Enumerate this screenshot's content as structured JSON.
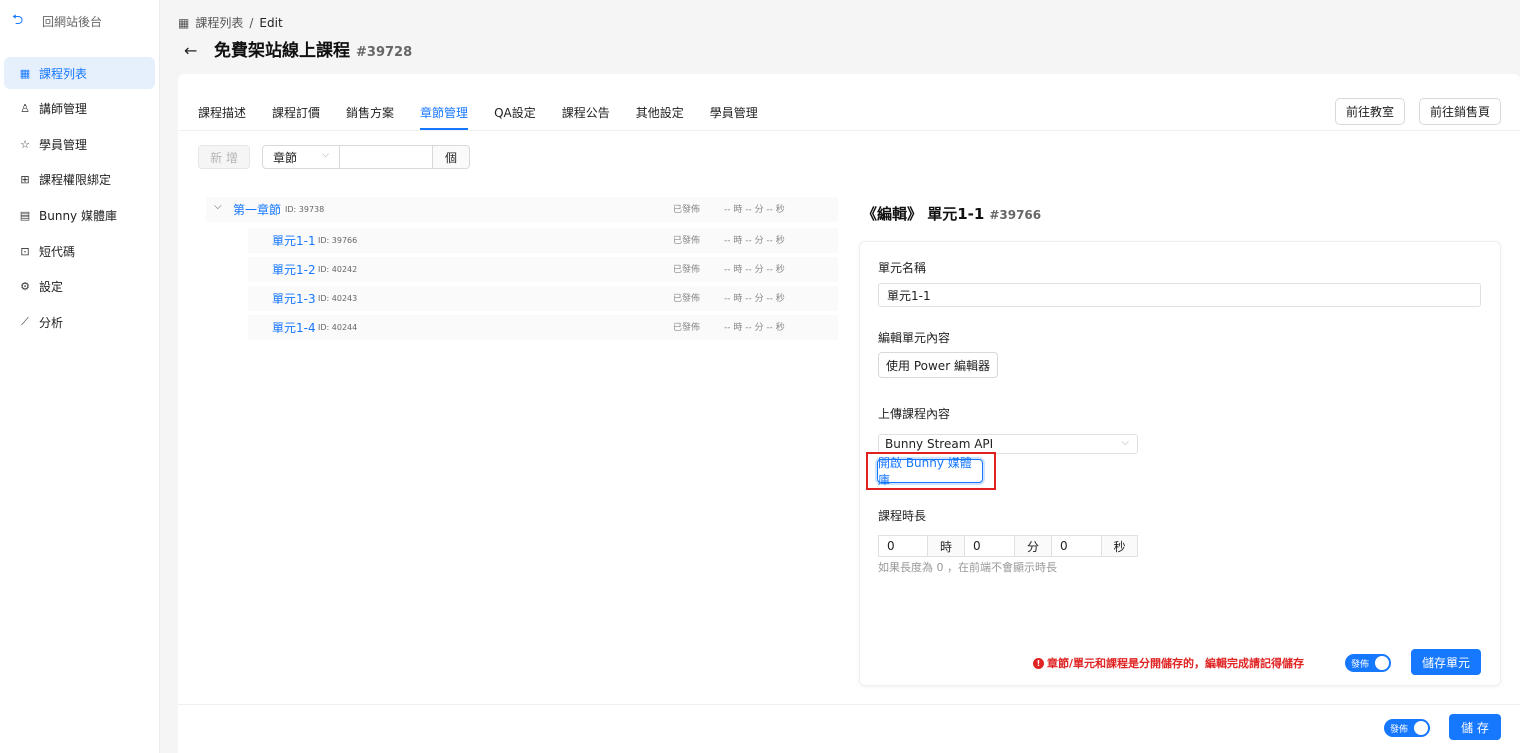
{
  "sidebar": {
    "back_label": "回網站後台",
    "items": [
      {
        "label": "課程列表",
        "icon": "table-icon",
        "glyph": "▦"
      },
      {
        "label": "講師管理",
        "icon": "user-icon",
        "glyph": "♙"
      },
      {
        "label": "學員管理",
        "icon": "student-icon",
        "glyph": "☆"
      },
      {
        "label": "課程權限綁定",
        "icon": "apps-icon",
        "glyph": "⊞"
      },
      {
        "label": "Bunny 媒體庫",
        "icon": "media-library-icon",
        "glyph": "▤"
      },
      {
        "label": "短代碼",
        "icon": "code-icon",
        "glyph": "⊡"
      },
      {
        "label": "設定",
        "icon": "gear-icon",
        "glyph": "⚙"
      },
      {
        "label": "分析",
        "icon": "chart-icon",
        "glyph": "⟋"
      }
    ]
  },
  "breadcrumb": {
    "root": "課程列表",
    "sep": "/",
    "current": "Edit"
  },
  "header": {
    "title": "免費架站線上課程",
    "id": "#39728"
  },
  "tabs": [
    "課程描述",
    "課程訂價",
    "銷售方案",
    "章節管理",
    "QA設定",
    "課程公告",
    "其他設定",
    "學員管理"
  ],
  "active_tab": "章節管理",
  "top_buttons": {
    "classroom": "前往教室",
    "sales_page": "前往銷售頁"
  },
  "toolbar": {
    "add_label": "新 增",
    "type_value": "章節",
    "count_suffix": "個"
  },
  "tree": {
    "chapter": {
      "name": "第一章節",
      "id": "ID: 39738",
      "status": "已發佈",
      "duration": "-- 時 -- 分 -- 秒"
    },
    "units": [
      {
        "name": "單元1-1",
        "id": "ID: 39766",
        "status": "已發佈",
        "duration": "-- 時 -- 分 -- 秒"
      },
      {
        "name": "單元1-2",
        "id": "ID: 40242",
        "status": "已發佈",
        "duration": "-- 時 -- 分 -- 秒"
      },
      {
        "name": "單元1-3",
        "id": "ID: 40243",
        "status": "已發佈",
        "duration": "-- 時 -- 分 -- 秒"
      },
      {
        "name": "單元1-4",
        "id": "ID: 40244",
        "status": "已發佈",
        "duration": "-- 時 -- 分 -- 秒"
      }
    ]
  },
  "edit": {
    "title": "《編輯》 單元1-1",
    "id": "#39766",
    "unit_name_label": "單元名稱",
    "unit_name_value": "單元1-1",
    "content_label": "編輯單元內容",
    "editor_button": "使用 Power 編輯器",
    "upload_label": "上傳課程內容",
    "upload_select": "Bunny Stream API",
    "bunny_button": "開啟 Bunny 媒體庫",
    "duration_label": "課程時長",
    "hours": "0",
    "hours_unit": "時",
    "minutes": "0",
    "minutes_unit": "分",
    "seconds": "0",
    "seconds_unit": "秒",
    "duration_hint": "如果長度為 0 ，在前端不會顯示時長",
    "warning": "章節/單元和課程是分開儲存的，編輯完成請記得儲存",
    "publish_toggle": "發佈",
    "save_unit": "儲存單元"
  },
  "footer": {
    "publish_toggle": "發佈",
    "save": "儲 存"
  },
  "colors": {
    "accent": "#1677ff",
    "warning": "#e02424",
    "highlight": "#e01f1f"
  }
}
